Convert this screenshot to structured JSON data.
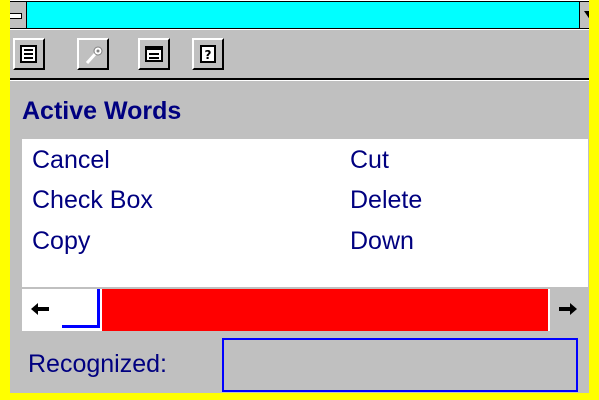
{
  "window": {
    "title": ""
  },
  "toolbar": {
    "buttons": [
      {
        "icon": "document-icon"
      },
      {
        "icon": "microphone-icon"
      },
      {
        "icon": "window-list-icon"
      },
      {
        "icon": "help-icon"
      }
    ]
  },
  "active_words": {
    "heading": "Active Words",
    "left_column": [
      "Cancel",
      "Check Box",
      "Copy"
    ],
    "right_column": [
      "Cut",
      "Delete",
      "Down"
    ]
  },
  "status": {
    "label": "Recognized:",
    "value": ""
  },
  "colors": {
    "caption": "#00ffff",
    "frame": "#ffff00",
    "text": "#000080",
    "scroll_track": "#ff0000"
  }
}
